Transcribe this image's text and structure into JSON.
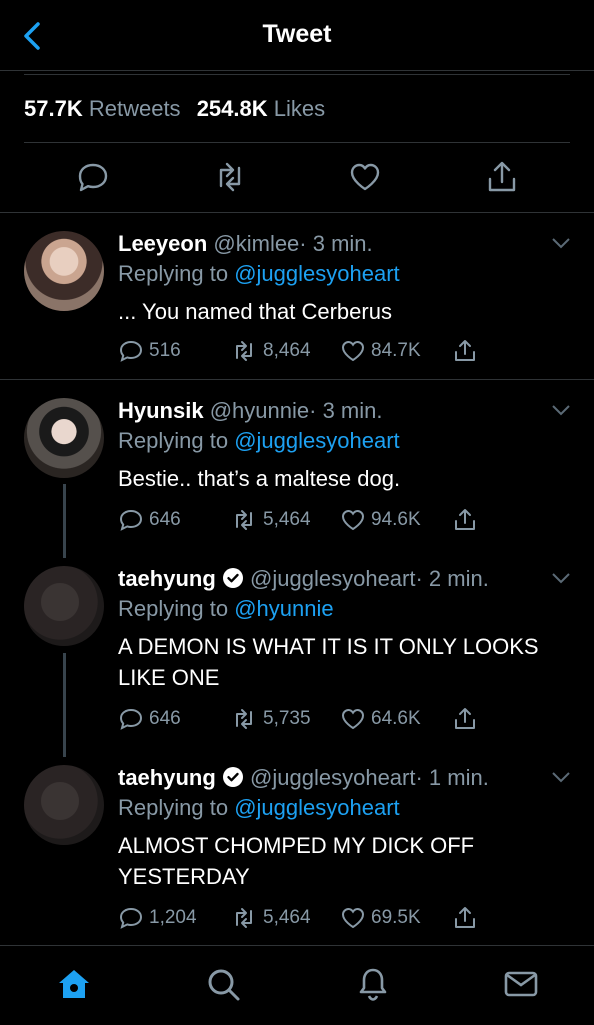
{
  "header": {
    "title": "Tweet"
  },
  "stats": {
    "retweets_count": "57.7K",
    "retweets_label": "Retweets",
    "likes_count": "254.8K",
    "likes_label": "Likes"
  },
  "tweets": [
    {
      "name": "Leeyeon",
      "handle": "@kimlee",
      "time": "· 3 min.",
      "replying_prefix": "Replying to",
      "replying_to": "@jugglesyoheart",
      "text": "... You named that Cerberus",
      "replies": "516",
      "retweets": "8,464",
      "likes": "84.7K"
    },
    {
      "name": "Hyunsik",
      "handle": "@hyunnie",
      "time": "· 3 min.",
      "replying_prefix": "Replying to",
      "replying_to": "@jugglesyoheart",
      "text": "Bestie.. that’s a maltese dog.",
      "replies": "646",
      "retweets": "5,464",
      "likes": "94.6K"
    },
    {
      "name": "taehyung",
      "handle": "@jugglesyoheart",
      "time": "· 2 min.",
      "replying_prefix": "Replying to",
      "replying_to": "@hyunnie",
      "text": "A DEMON IS WHAT IT IS IT ONLY LOOKS LIKE ONE",
      "replies": "646",
      "retweets": "5,735",
      "likes": "64.6K"
    },
    {
      "name": "taehyung",
      "handle": "@jugglesyoheart",
      "time": "· 1 min.",
      "replying_prefix": "Replying to",
      "replying_to": "@jugglesyoheart",
      "text": "ALMOST CHOMPED MY DICK OFF YESTERDAY",
      "replies": "1,204",
      "retweets": "5,464",
      "likes": "69.5K"
    }
  ],
  "colors": {
    "accent": "#1da1f2",
    "muted": "#8899a6",
    "background": "#000000",
    "divider": "#2f3336"
  },
  "icons": {
    "back": "chevron-left-icon",
    "reply": "comment-icon",
    "retweet": "retweet-icon",
    "like": "heart-icon",
    "share": "share-icon",
    "home": "home-icon",
    "search": "search-icon",
    "notifications": "bell-icon",
    "messages": "mail-icon",
    "verified": "verified-badge-icon"
  }
}
